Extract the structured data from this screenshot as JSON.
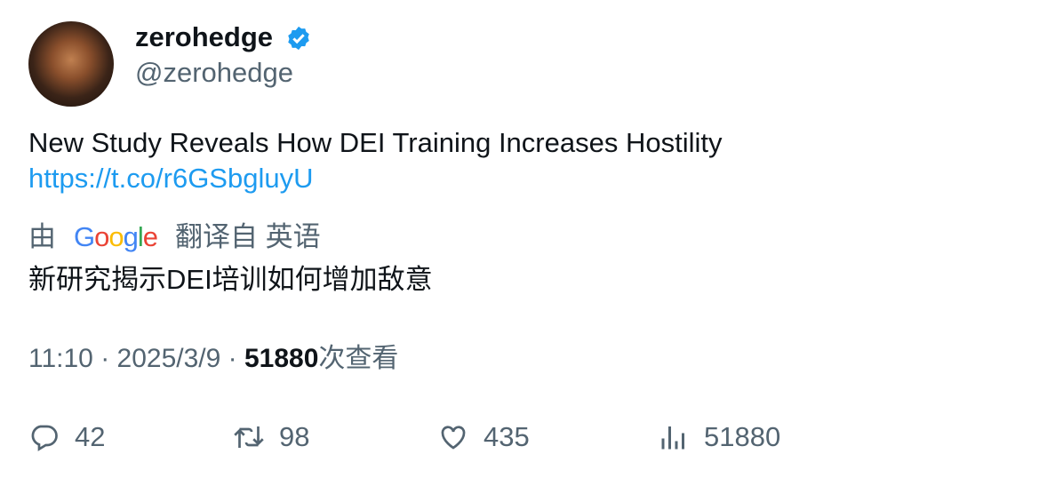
{
  "user": {
    "name": "zerohedge",
    "handle": "@zerohedge",
    "verified_color": "#1d9bf0"
  },
  "tweet": {
    "text": "New Study Reveals How DEI Training Increases Hostility",
    "link": "https://t.co/r6GSbgluyU"
  },
  "translation": {
    "by": "由",
    "provider": "Google",
    "from": "翻译自 英语",
    "text": "新研究揭示DEI培训如何增加敌意"
  },
  "meta": {
    "time": "11:10",
    "date": "2025/3/9",
    "views": "51880",
    "views_label": "次查看",
    "sep": " · "
  },
  "actions": {
    "replies": "42",
    "retweets": "98",
    "likes": "435",
    "views": "51880"
  }
}
